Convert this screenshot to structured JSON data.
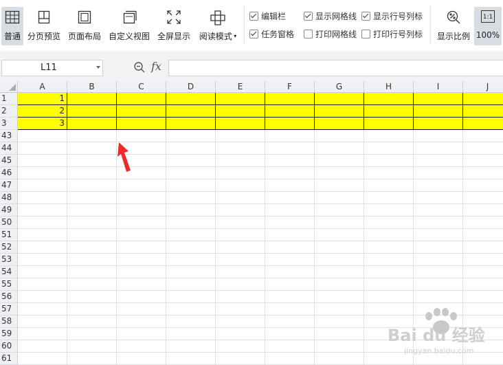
{
  "ribbon": {
    "buttons": [
      {
        "id": "normal",
        "label": "普通",
        "icon": "normal-view-icon",
        "active": true
      },
      {
        "id": "page-break",
        "label": "分页预览",
        "icon": "page-break-preview-icon",
        "active": false
      },
      {
        "id": "page-layout",
        "label": "页面布局",
        "icon": "page-layout-icon",
        "active": false
      },
      {
        "id": "custom-view",
        "label": "自定义视图",
        "icon": "custom-view-icon",
        "active": false
      },
      {
        "id": "full-screen",
        "label": "全屏显示",
        "icon": "full-screen-icon",
        "active": false
      },
      {
        "id": "reading",
        "label": "阅读模式",
        "icon": "reading-mode-icon",
        "active": false
      }
    ],
    "checks": [
      {
        "label": "编辑栏",
        "checked": true
      },
      {
        "label": "任务窗格",
        "checked": true
      },
      {
        "label": "显示网格线",
        "checked": true
      },
      {
        "label": "打印网格线",
        "checked": false
      },
      {
        "label": "显示行号列标",
        "checked": true
      },
      {
        "label": "打印行号列标",
        "checked": false
      }
    ],
    "zoom_label": "显示比例",
    "zoom_100_label": "100%",
    "zoom_100_icon_text": "1:1"
  },
  "formula_bar": {
    "cell_ref": "L11",
    "fx_label": "fx",
    "value": ""
  },
  "sheet": {
    "columns": [
      "A",
      "B",
      "C",
      "D",
      "E",
      "F",
      "G",
      "H",
      "I",
      "J"
    ],
    "rows": [
      {
        "label": "1",
        "values": [
          "1",
          "",
          "",
          "",
          "",
          "",
          "",
          "",
          "",
          ""
        ],
        "highlight": true
      },
      {
        "label": "2",
        "values": [
          "2",
          "",
          "",
          "",
          "",
          "",
          "",
          "",
          "",
          ""
        ],
        "highlight": true
      },
      {
        "label": "3",
        "values": [
          "3",
          "",
          "",
          "",
          "",
          "",
          "",
          "",
          "",
          ""
        ],
        "highlight": true
      },
      {
        "label": "43",
        "values": []
      },
      {
        "label": "44",
        "values": []
      },
      {
        "label": "45",
        "values": []
      },
      {
        "label": "46",
        "values": []
      },
      {
        "label": "47",
        "values": []
      },
      {
        "label": "48",
        "values": []
      },
      {
        "label": "49",
        "values": []
      },
      {
        "label": "50",
        "values": []
      },
      {
        "label": "51",
        "values": []
      },
      {
        "label": "52",
        "values": []
      },
      {
        "label": "53",
        "values": []
      },
      {
        "label": "54",
        "values": []
      },
      {
        "label": "55",
        "values": []
      },
      {
        "label": "56",
        "values": []
      },
      {
        "label": "57",
        "values": []
      },
      {
        "label": "58",
        "values": []
      },
      {
        "label": "59",
        "values": []
      },
      {
        "label": "60",
        "values": []
      },
      {
        "label": "61",
        "values": []
      }
    ],
    "highlight_color": "#ffff00"
  },
  "watermark": {
    "text": "Bai du 经验",
    "sub": "jingyan.baidu.com"
  }
}
